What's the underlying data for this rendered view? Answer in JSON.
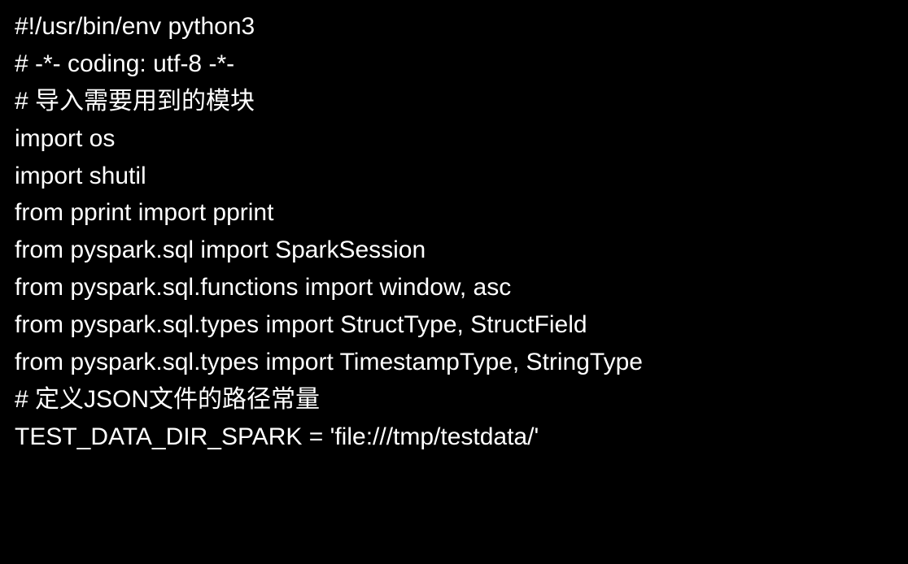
{
  "code": {
    "lines": [
      "#!/usr/bin/env python3",
      "# -*- coding: utf-8 -*-",
      "",
      "# 导入需要用到的模块",
      "import os",
      "import shutil",
      "from pprint import pprint",
      "",
      "from pyspark.sql import SparkSession",
      "from pyspark.sql.functions import window, asc",
      "from pyspark.sql.types import StructType, StructField",
      "from pyspark.sql.types import TimestampType, StringType",
      "# 定义JSON文件的路径常量",
      "TEST_DATA_DIR_SPARK = 'file:///tmp/testdata/'"
    ]
  }
}
